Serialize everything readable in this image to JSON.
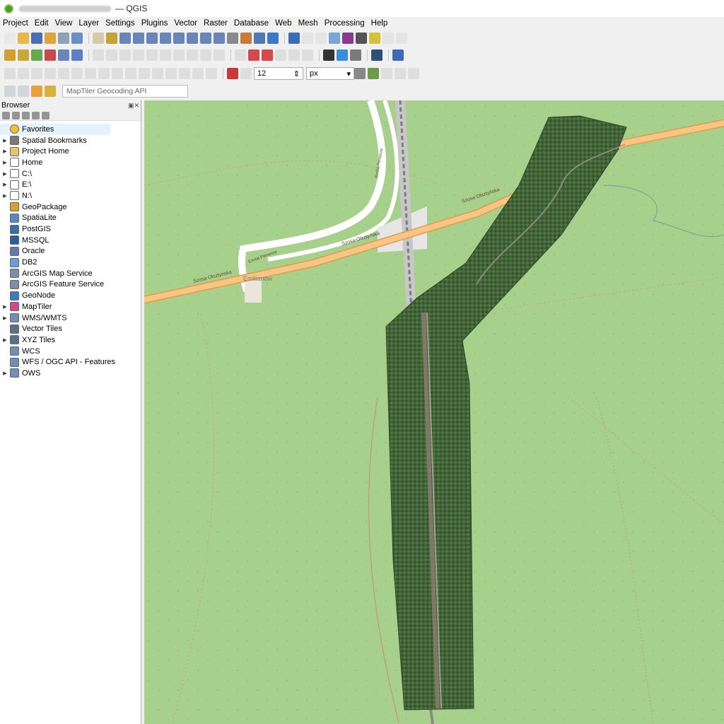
{
  "window": {
    "app_title": "— QGIS"
  },
  "menu": [
    "Project",
    "Edit",
    "View",
    "Layer",
    "Settings",
    "Plugins",
    "Vector",
    "Raster",
    "Database",
    "Web",
    "Mesh",
    "Processing",
    "Help"
  ],
  "toolbar": {
    "font_size_value": "12",
    "font_unit": "px",
    "geocoding_placeholder": "MapTiler Geocoding API"
  },
  "browser": {
    "title": "Browser",
    "items": [
      {
        "label": "Favorites",
        "icon": "star-icon",
        "expandable": false,
        "selected": true
      },
      {
        "label": "Spatial Bookmarks",
        "icon": "bookmark-icon",
        "expandable": true
      },
      {
        "label": "Project Home",
        "icon": "folder-icon",
        "expandable": true
      },
      {
        "label": "Home",
        "icon": "home-folder-icon",
        "expandable": true
      },
      {
        "label": "C:\\",
        "icon": "drive-icon",
        "expandable": true
      },
      {
        "label": "E:\\",
        "icon": "drive-icon",
        "expandable": true
      },
      {
        "label": "N:\\",
        "icon": "drive-icon",
        "expandable": true
      },
      {
        "label": "GeoPackage",
        "icon": "geopackage-icon",
        "expandable": false
      },
      {
        "label": "SpatiaLite",
        "icon": "spatialite-icon",
        "expandable": false
      },
      {
        "label": "PostGIS",
        "icon": "postgis-icon",
        "expandable": false
      },
      {
        "label": "MSSQL",
        "icon": "mssql-icon",
        "expandable": false
      },
      {
        "label": "Oracle",
        "icon": "oracle-icon",
        "expandable": false
      },
      {
        "label": "DB2",
        "icon": "db2-icon",
        "expandable": false
      },
      {
        "label": "ArcGIS Map Service",
        "icon": "arcgis-map-icon",
        "expandable": false
      },
      {
        "label": "ArcGIS Feature Service",
        "icon": "arcgis-feature-icon",
        "expandable": false
      },
      {
        "label": "GeoNode",
        "icon": "geonode-icon",
        "expandable": false
      },
      {
        "label": "MapTiler",
        "icon": "maptiler-icon",
        "expandable": true
      },
      {
        "label": "WMS/WMTS",
        "icon": "wms-icon",
        "expandable": true
      },
      {
        "label": "Vector Tiles",
        "icon": "vector-tiles-icon",
        "expandable": false
      },
      {
        "label": "XYZ Tiles",
        "icon": "xyz-tiles-icon",
        "expandable": true
      },
      {
        "label": "WCS",
        "icon": "wcs-icon",
        "expandable": false
      },
      {
        "label": "WFS / OGC API - Features",
        "icon": "wfs-icon",
        "expandable": false
      },
      {
        "label": "OWS",
        "icon": "ows-icon",
        "expandable": true
      }
    ]
  },
  "map": {
    "street_labels": [
      "Szosa Olsztyńska",
      "Szosa Olsztyńska",
      "Szosa Olsztyńska",
      "Emilia Pierwsza",
      "Emilia Pierwsza"
    ],
    "place_label": "Emilianów",
    "colors": {
      "background": "#a7d08c",
      "road": "#f2b36b",
      "orthophoto": "#3f6236"
    }
  }
}
